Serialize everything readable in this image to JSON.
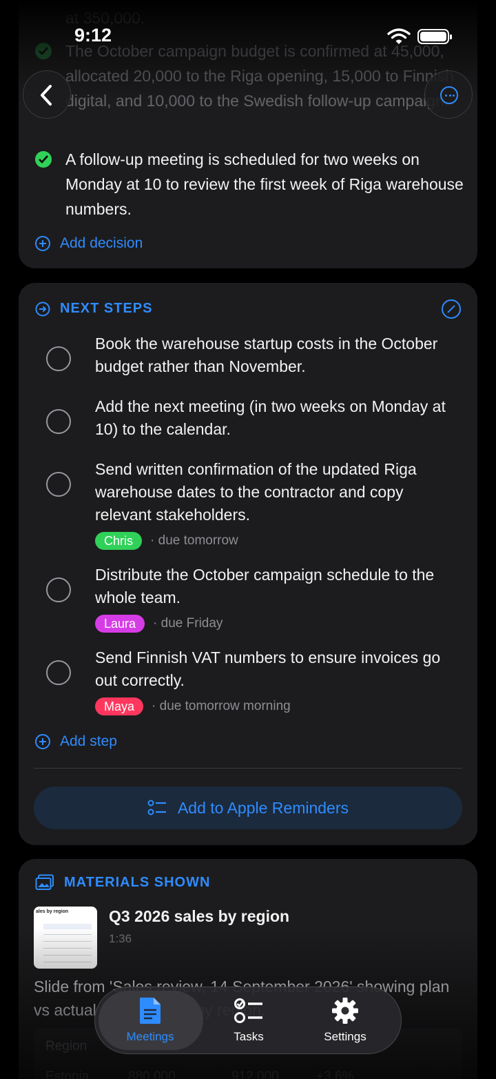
{
  "status_bar": {
    "time": "9:12"
  },
  "decisions": {
    "items": [
      {
        "text": "The October campaign budget is confirmed at 45,000, allocated 20,000 to the Riga opening, 15,000 to Finnish digital, and 10,000 to the Swedish follow-up campaign.",
        "partial_above": "at 350,000."
      },
      {
        "text": "A follow-up meeting is scheduled for two weeks on Monday at 10 to review the first week of Riga warehouse numbers."
      }
    ],
    "add_label": "Add decision"
  },
  "next_steps": {
    "title": "NEXT STEPS",
    "items": [
      {
        "text": "Book the warehouse startup costs in the October budget rather than November."
      },
      {
        "text": "Add the next meeting (in two weeks on Monday at 10) to the calendar."
      },
      {
        "text": "Send written confirmation of the updated Riga warehouse dates to the contractor and copy relevant stakeholders.",
        "assignee": "Chris",
        "assignee_color": "#30d158",
        "due": "· due tomorrow"
      },
      {
        "text": "Distribute the October campaign schedule to the whole team.",
        "assignee": "Laura",
        "assignee_color": "#d63ce6",
        "due": "· due Friday"
      },
      {
        "text": "Send Finnish VAT numbers to ensure invoices go out correctly.",
        "assignee": "Maya",
        "assignee_color": "#ff375f",
        "due": "· due tomorrow morning"
      }
    ],
    "add_label": "Add step",
    "reminders_label": "Add to Apple Reminders"
  },
  "materials": {
    "title": "MATERIALS SHOWN",
    "item": {
      "thumb_title": "ales by region",
      "title": "Q3 2026 sales by region",
      "time": "1:36",
      "description": "Slide from 'Sales review, 14 September 2026' showing plan vs actual and variance by region."
    },
    "table": {
      "header": "Region",
      "row": [
        "Estonia",
        "880,000",
        "912,000",
        "+3.6%"
      ]
    }
  },
  "tab_bar": {
    "tabs": [
      {
        "label": "Meetings",
        "active": true
      },
      {
        "label": "Tasks"
      },
      {
        "label": "Settings"
      }
    ]
  },
  "colors": {
    "accent": "#2f8cff",
    "card": "#1c1c1e",
    "success": "#30d158"
  }
}
